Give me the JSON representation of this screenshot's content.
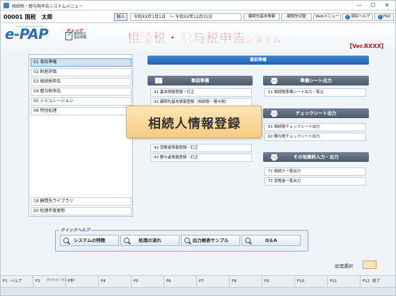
{
  "window": {
    "title": "相続税・贈与税申告システムメニュー",
    "controls": {
      "minimize": "—",
      "maximize": "☐",
      "close": "✕"
    }
  },
  "toolbar": {
    "user": "00001 国税　太郎",
    "badge": "個人",
    "period": "令和XX年1月1日　～ 令和XX年12月31日",
    "buttons": [
      "顧問先基本情報",
      "顧問先切替",
      "Webメニュー",
      "項目ヘルプ",
      "FAQ"
    ]
  },
  "header": {
    "logo": "e-PAP",
    "logo_sub": "Smart Gateway Accelerator",
    "check_top": "チェック",
    "check_text": "最新改正 強化情報",
    "title_main": "相続税・贈与税申告",
    "title_small": "システム",
    "version": "【Ver.RXXX】"
  },
  "menu_left": [
    {
      "label": "01 事前準備",
      "selected": true
    },
    {
      "label": "02 財産評価",
      "selected": false
    },
    {
      "label": "03 相続税申告",
      "selected": false
    },
    {
      "label": "04 贈与税申告",
      "selected": false
    },
    {
      "label": "05 シミュレーション",
      "selected": false
    },
    {
      "label": "06 特別処理",
      "selected": false
    }
  ],
  "menu_left_bottom": [
    "19 顧問先ライブラリ",
    "20 処理年度更新"
  ],
  "section_title": "事前準備",
  "groups": {
    "prep": {
      "title": "事前準備",
      "items": [
        "31 基本情報登録・訂正",
        "32 顧問先基本情報登録（相続税・贈与税）",
        "42 受贈者情報登録・訂正",
        "43 贈与者情報登録・訂正"
      ]
    },
    "sheet": {
      "title": "準備シート出力",
      "items": [
        "51 相続税準備シート出力・取込"
      ]
    },
    "checksheet": {
      "title": "チェックシート出力",
      "items": [
        "61 相続税チェックシート出力",
        "62 贈与税チェックシート出力"
      ]
    },
    "other": {
      "title": "その他資料入力・出力",
      "items": [
        "71 相続人一覧出力",
        "72 受贈者一覧出力"
      ]
    }
  },
  "popup": {
    "label": "相続人情報登録"
  },
  "quick_help": {
    "label": "クイックヘルプ",
    "buttons": [
      "システムの特徴",
      "処理の流れ",
      "出力帳表サンプル",
      "Q＆A"
    ]
  },
  "shori": {
    "label": "処理選択"
  },
  "fkeys": [
    {
      "key": "F1",
      "label": "ヘルプ"
    },
    {
      "key": "F2",
      "label": "オフライン マニュアル"
    },
    {
      "key": "F3",
      "label": ""
    },
    {
      "key": "F4",
      "label": ""
    },
    {
      "key": "F5",
      "label": ""
    },
    {
      "key": "F6",
      "label": ""
    },
    {
      "key": "F7",
      "label": ""
    },
    {
      "key": "F8",
      "label": ""
    },
    {
      "key": "F9",
      "label": ""
    },
    {
      "key": "F10",
      "label": ""
    },
    {
      "key": "F11",
      "label": ""
    },
    {
      "key": "F12",
      "label": "終了"
    }
  ],
  "colors": {
    "accent": "#2d6fb2",
    "title_red": "#c0181f",
    "section_blue": "#1f5fae",
    "group_gray": "#4d5b6b",
    "popup": "#f7cb80"
  }
}
